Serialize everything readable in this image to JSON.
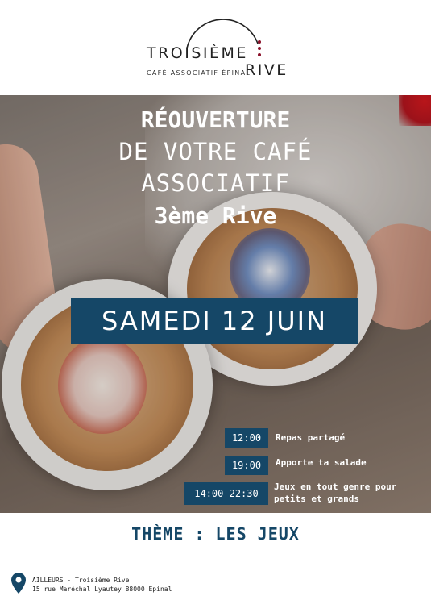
{
  "logo": {
    "line1": "TROISIÈME",
    "line2": "RIVE",
    "subtitle": "CAFÉ ASSOCIATIF ÉPINAL"
  },
  "headline": {
    "line1": "RÉOUVERTURE",
    "line2": "DE VOTRE CAFÉ",
    "line3": "ASSOCIATIF",
    "line4": "3ème Rive"
  },
  "date": "SAMEDI 12 JUIN",
  "schedule": [
    {
      "time": "12:00",
      "activity": "Repas partagé"
    },
    {
      "time": "19:00",
      "activity": "Apporte ta salade"
    },
    {
      "time": "14:00-22:30",
      "activity": "Jeux en tout genre pour petits et grands"
    }
  ],
  "theme": "THÈME : LES JEUX",
  "address": {
    "line1": "AILLEURS - Troisième Rive",
    "line2": "15 rue Maréchal Lyautey 88000 Epinal"
  },
  "colors": {
    "accent": "#154767",
    "logo_dots": "#8a1029"
  },
  "icons": {
    "location": "map-pin-icon"
  }
}
